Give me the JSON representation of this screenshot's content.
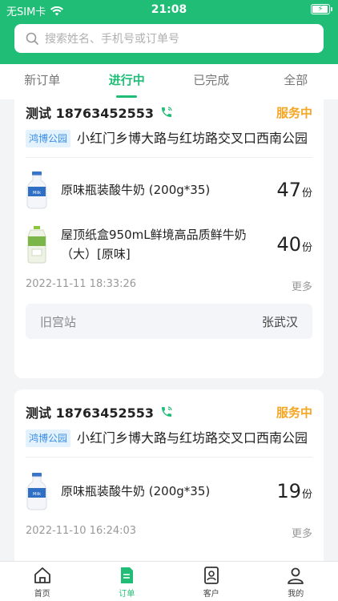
{
  "status_bar": {
    "carrier": "无SIM卡",
    "time": "21:08"
  },
  "search": {
    "placeholder": "搜索姓名、手机号或订单号"
  },
  "tabs": [
    {
      "label": "新订单"
    },
    {
      "label": "进行中",
      "active": true
    },
    {
      "label": "已完成"
    },
    {
      "label": "全部"
    }
  ],
  "orders": [
    {
      "contact": "测试 18763452553",
      "status": "服务中",
      "tag": "鸿博公园",
      "address": "小红门乡博大路与红坊路交叉口西南公园",
      "products": [
        {
          "name": "原味瓶装酸牛奶 (200g*35)",
          "qty": "47",
          "unit": "份",
          "icon": "yogurt-bottle-icon"
        },
        {
          "name": "屋顶纸盒950mL鲜境高品质鲜牛奶（大）[原味]",
          "qty": "40",
          "unit": "份",
          "icon": "milk-carton-icon"
        }
      ],
      "date": "2022-11-11 18:33:26",
      "more": "更多",
      "route_from": "旧宫站",
      "route_to": "张武汉"
    },
    {
      "contact": "测试 18763452553",
      "status": "服务中",
      "tag": "鸿博公园",
      "address": "小红门乡博大路与红坊路交叉口西南公园",
      "products": [
        {
          "name": "原味瓶装酸牛奶 (200g*35)",
          "qty": "19",
          "unit": "份",
          "icon": "yogurt-bottle-icon"
        }
      ],
      "date": "2022-11-10 16:24:03",
      "more": "更多"
    }
  ],
  "bottom_nav": [
    {
      "label": "首页",
      "icon": "home-icon"
    },
    {
      "label": "订单",
      "icon": "orders-icon",
      "active": true
    },
    {
      "label": "客户",
      "icon": "customer-icon"
    },
    {
      "label": "我的",
      "icon": "profile-icon"
    }
  ],
  "colors": {
    "brand": "#1fbd75",
    "status": "#f5a623",
    "tag_bg": "#e3f2fd",
    "tag_text": "#3a8ee6"
  }
}
